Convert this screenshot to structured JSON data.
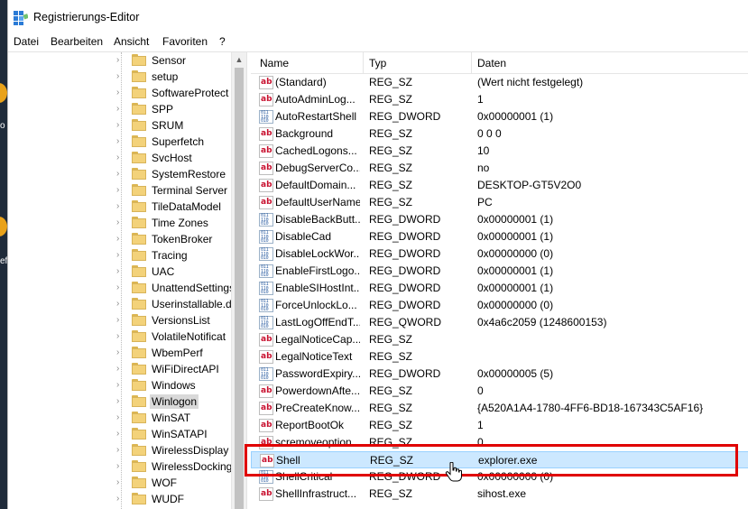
{
  "window": {
    "title": "Registrierungs-Editor"
  },
  "desktop": {
    "labels": [
      "o",
      "ef"
    ]
  },
  "menu": [
    "Datei",
    "Bearbeiten",
    "Ansicht",
    "Favoriten",
    "?"
  ],
  "tree": {
    "items": [
      {
        "label": "Sensor"
      },
      {
        "label": "setup"
      },
      {
        "label": "SoftwareProtect"
      },
      {
        "label": "SPP"
      },
      {
        "label": "SRUM"
      },
      {
        "label": "Superfetch"
      },
      {
        "label": "SvcHost"
      },
      {
        "label": "SystemRestore"
      },
      {
        "label": "Terminal Server"
      },
      {
        "label": "TileDataModel"
      },
      {
        "label": "Time Zones"
      },
      {
        "label": "TokenBroker"
      },
      {
        "label": "Tracing"
      },
      {
        "label": "UAC"
      },
      {
        "label": "UnattendSettings"
      },
      {
        "label": "Userinstallable.d"
      },
      {
        "label": "VersionsList"
      },
      {
        "label": "VolatileNotificat"
      },
      {
        "label": "WbemPerf"
      },
      {
        "label": "WiFiDirectAPI"
      },
      {
        "label": "Windows"
      },
      {
        "label": "Winlogon",
        "selected": true
      },
      {
        "label": "WinSAT"
      },
      {
        "label": "WinSATAPI"
      },
      {
        "label": "WirelessDisplay"
      },
      {
        "label": "WirelessDocking"
      },
      {
        "label": "WOF"
      },
      {
        "label": "WUDF"
      }
    ]
  },
  "list": {
    "columns": [
      "Name",
      "Typ",
      "Daten"
    ],
    "rows": [
      {
        "icon": "string-value-icon",
        "name": "(Standard)",
        "type": "REG_SZ",
        "data": "(Wert nicht festgelegt)"
      },
      {
        "icon": "string-value-icon",
        "name": "AutoAdminLog...",
        "type": "REG_SZ",
        "data": "1"
      },
      {
        "icon": "binary-value-icon",
        "name": "AutoRestartShell",
        "type": "REG_DWORD",
        "data": "0x00000001 (1)"
      },
      {
        "icon": "string-value-icon",
        "name": "Background",
        "type": "REG_SZ",
        "data": "0 0 0"
      },
      {
        "icon": "string-value-icon",
        "name": "CachedLogons...",
        "type": "REG_SZ",
        "data": "10"
      },
      {
        "icon": "string-value-icon",
        "name": "DebugServerCo...",
        "type": "REG_SZ",
        "data": "no"
      },
      {
        "icon": "string-value-icon",
        "name": "DefaultDomain...",
        "type": "REG_SZ",
        "data": "DESKTOP-GT5V2O0"
      },
      {
        "icon": "string-value-icon",
        "name": "DefaultUserName",
        "type": "REG_SZ",
        "data": "PC"
      },
      {
        "icon": "binary-value-icon",
        "name": "DisableBackButt...",
        "type": "REG_DWORD",
        "data": "0x00000001 (1)"
      },
      {
        "icon": "binary-value-icon",
        "name": "DisableCad",
        "type": "REG_DWORD",
        "data": "0x00000001 (1)"
      },
      {
        "icon": "binary-value-icon",
        "name": "DisableLockWor...",
        "type": "REG_DWORD",
        "data": "0x00000000 (0)"
      },
      {
        "icon": "binary-value-icon",
        "name": "EnableFirstLogo...",
        "type": "REG_DWORD",
        "data": "0x00000001 (1)"
      },
      {
        "icon": "binary-value-icon",
        "name": "EnableSIHostInt...",
        "type": "REG_DWORD",
        "data": "0x00000001 (1)"
      },
      {
        "icon": "binary-value-icon",
        "name": "ForceUnlockLo...",
        "type": "REG_DWORD",
        "data": "0x00000000 (0)"
      },
      {
        "icon": "binary-value-icon",
        "name": "LastLogOffEndT...",
        "type": "REG_QWORD",
        "data": "0x4a6c2059 (1248600153)"
      },
      {
        "icon": "string-value-icon",
        "name": "LegalNoticeCap...",
        "type": "REG_SZ",
        "data": ""
      },
      {
        "icon": "string-value-icon",
        "name": "LegalNoticeText",
        "type": "REG_SZ",
        "data": ""
      },
      {
        "icon": "binary-value-icon",
        "name": "PasswordExpiry...",
        "type": "REG_DWORD",
        "data": "0x00000005 (5)"
      },
      {
        "icon": "string-value-icon",
        "name": "PowerdownAfte...",
        "type": "REG_SZ",
        "data": "0"
      },
      {
        "icon": "string-value-icon",
        "name": "PreCreateKnow...",
        "type": "REG_SZ",
        "data": "{A520A1A4-1780-4FF6-BD18-167343C5AF16}"
      },
      {
        "icon": "string-value-icon",
        "name": "ReportBootOk",
        "type": "REG_SZ",
        "data": "1"
      },
      {
        "icon": "string-value-icon",
        "name": "scremoveoption",
        "type": "REG_SZ",
        "data": "0"
      },
      {
        "icon": "string-value-icon",
        "name": "Shell",
        "type": "REG_SZ",
        "data": "explorer.exe",
        "selected": true
      },
      {
        "icon": "binary-value-icon",
        "name": "ShellCritical",
        "type": "REG_DWORD",
        "data": "0x00000000 (0)"
      },
      {
        "icon": "string-value-icon",
        "name": "ShellInfrastruct...",
        "type": "REG_SZ",
        "data": "sihost.exe"
      }
    ]
  },
  "colors": {
    "selection_bg": "#cce8ff",
    "selection_border": "#99d1ff",
    "highlight_box": "#e00000",
    "folder": "#f3d27a"
  }
}
